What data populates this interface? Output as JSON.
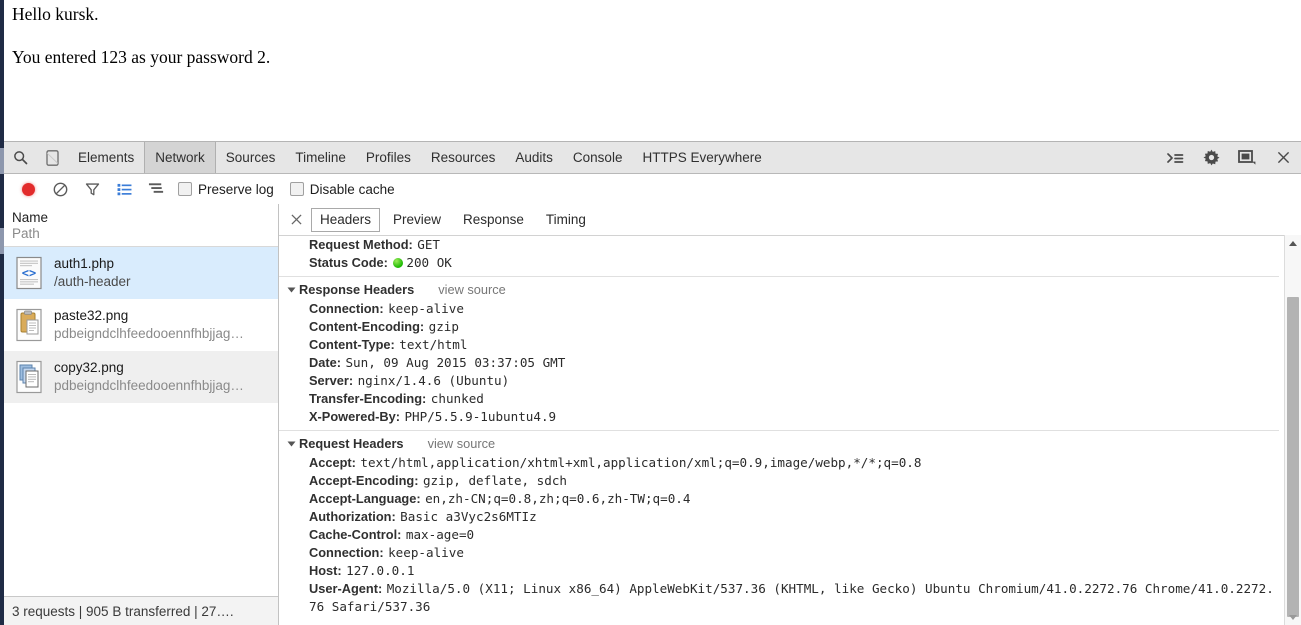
{
  "page_content": {
    "line1": "Hello kursk.",
    "line2": "You entered 123 as your password 2."
  },
  "devtools": {
    "icons": {
      "search": "search-icon",
      "device": "device-toggle-icon"
    },
    "tabs": [
      {
        "label": "Elements",
        "active": false
      },
      {
        "label": "Network",
        "active": true
      },
      {
        "label": "Sources",
        "active": false
      },
      {
        "label": "Timeline",
        "active": false
      },
      {
        "label": "Profiles",
        "active": false
      },
      {
        "label": "Resources",
        "active": false
      },
      {
        "label": "Audits",
        "active": false
      },
      {
        "label": "Console",
        "active": false
      },
      {
        "label": "HTTPS Everywhere",
        "active": false
      }
    ],
    "right_icons": [
      "console-drawer-icon",
      "settings-gear-icon",
      "dock-position-icon",
      "close-icon"
    ],
    "network_toolbar": {
      "record_label": "record-button",
      "clear_label": "clear-button",
      "filter_label": "filter-button",
      "view_list_label": "view-list-button",
      "waterfall_label": "waterfall-button",
      "preserve_log": "Preserve log",
      "preserve_log_checked": false,
      "disable_cache": "Disable cache",
      "disable_cache_checked": false
    },
    "sidebar": {
      "col_name": "Name",
      "col_path": "Path",
      "requests": [
        {
          "name": "auth1.php",
          "path": "/auth-header",
          "icon": "document-code-icon",
          "selected": true
        },
        {
          "name": "paste32.png",
          "path": "pdbeigndclhfeedooennfhbjjag…",
          "icon": "paste-image-icon",
          "selected": false
        },
        {
          "name": "copy32.png",
          "path": "pdbeigndclhfeedooennfhbjjag…",
          "icon": "copy-image-icon",
          "selected": false
        }
      ],
      "status": "3 requests | 905 B transferred | 27…."
    },
    "detail": {
      "tabs": [
        {
          "label": "Headers",
          "active": true
        },
        {
          "label": "Preview",
          "active": false
        },
        {
          "label": "Response",
          "active": false
        },
        {
          "label": "Timing",
          "active": false
        }
      ],
      "general": [
        {
          "key": "Request Method:",
          "value": "GET"
        },
        {
          "key": "Status Code:",
          "value": "200  OK",
          "dot": "green"
        }
      ],
      "response_headers": {
        "title": "Response Headers",
        "view_source": "view source",
        "items": [
          {
            "key": "Connection:",
            "value": "keep-alive"
          },
          {
            "key": "Content-Encoding:",
            "value": "gzip"
          },
          {
            "key": "Content-Type:",
            "value": "text/html"
          },
          {
            "key": "Date:",
            "value": "Sun, 09 Aug 2015 03:37:05 GMT"
          },
          {
            "key": "Server:",
            "value": "nginx/1.4.6 (Ubuntu)"
          },
          {
            "key": "Transfer-Encoding:",
            "value": "chunked"
          },
          {
            "key": "X-Powered-By:",
            "value": "PHP/5.5.9-1ubuntu4.9"
          }
        ]
      },
      "request_headers": {
        "title": "Request Headers",
        "view_source": "view source",
        "items": [
          {
            "key": "Accept:",
            "value": "text/html,application/xhtml+xml,application/xml;q=0.9,image/webp,*/*;q=0.8"
          },
          {
            "key": "Accept-Encoding:",
            "value": "gzip, deflate, sdch"
          },
          {
            "key": "Accept-Language:",
            "value": "en,zh-CN;q=0.8,zh;q=0.6,zh-TW;q=0.4"
          },
          {
            "key": "Authorization:",
            "value": "Basic a3Vyc2s6MTIz"
          },
          {
            "key": "Cache-Control:",
            "value": "max-age=0"
          },
          {
            "key": "Connection:",
            "value": "keep-alive"
          },
          {
            "key": "Host:",
            "value": "127.0.0.1"
          },
          {
            "key": "User-Agent:",
            "value": "Mozilla/5.0 (X11; Linux x86_64) AppleWebKit/537.36 (KHTML, like Gecko) Ubuntu Chromium/41.0.2272.76 Chrome/41.0.2272.76 Safari/537.36"
          }
        ]
      }
    }
  },
  "colors": {
    "tabbar_bg": "#e6e6e6",
    "active_tab_bg": "#d4d4d4",
    "selected_row_bg": "#d9ecfd",
    "alt_row_bg": "#efefef",
    "record_red": "#e22b2b",
    "status_green": "#19b800",
    "window_border": "#1f2b45"
  }
}
